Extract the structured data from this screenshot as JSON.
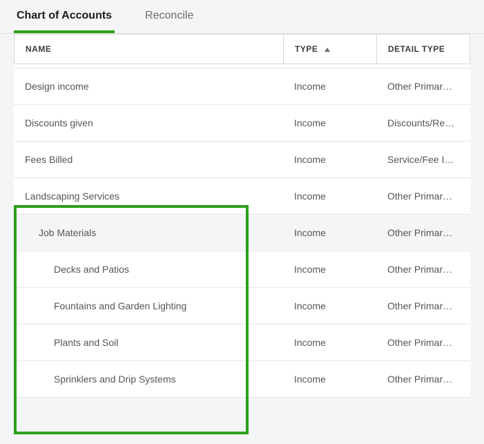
{
  "tabs": {
    "chart": "Chart of Accounts",
    "reconcile": "Reconcile"
  },
  "columns": {
    "name": "NAME",
    "type": "TYPE",
    "detail": "DETAIL TYPE"
  },
  "rows": [
    {
      "name": "Design income",
      "type": "Income",
      "detail": "Other Primar…",
      "indent": 0,
      "highlight": false
    },
    {
      "name": "Discounts given",
      "type": "Income",
      "detail": "Discounts/Re…",
      "indent": 0,
      "highlight": false
    },
    {
      "name": "Fees Billed",
      "type": "Income",
      "detail": "Service/Fee I…",
      "indent": 0,
      "highlight": false
    },
    {
      "name": "Landscaping Services",
      "type": "Income",
      "detail": "Other Primar…",
      "indent": 0,
      "highlight": false
    },
    {
      "name": "Job Materials",
      "type": "Income",
      "detail": "Other Primar…",
      "indent": 1,
      "highlight": true
    },
    {
      "name": "Decks and Patios",
      "type": "Income",
      "detail": "Other Primar…",
      "indent": 2,
      "highlight": false
    },
    {
      "name": "Fountains and Garden Lighting",
      "type": "Income",
      "detail": "Other Primar…",
      "indent": 2,
      "highlight": false
    },
    {
      "name": "Plants and Soil",
      "type": "Income",
      "detail": "Other Primar…",
      "indent": 2,
      "highlight": false
    },
    {
      "name": "Sprinklers and Drip Systems",
      "type": "Income",
      "detail": "Other Primar…",
      "indent": 2,
      "highlight": false
    }
  ]
}
